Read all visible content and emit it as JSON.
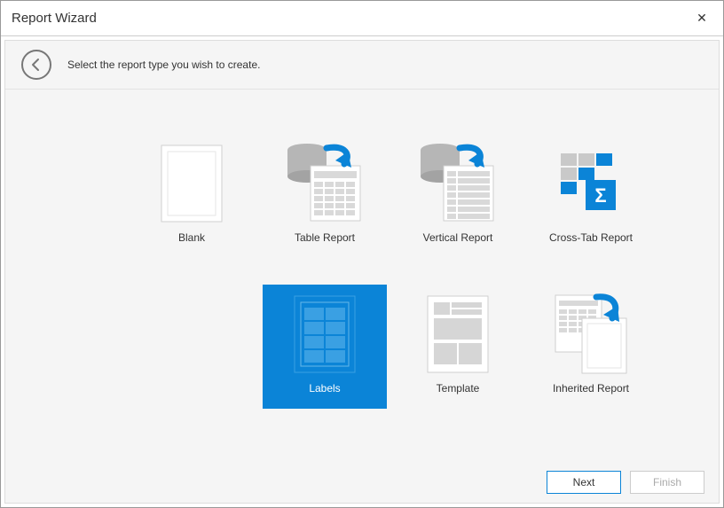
{
  "window": {
    "title": "Report Wizard",
    "close_glyph": "✕"
  },
  "header": {
    "instruction": "Select the report type you wish to create."
  },
  "tiles": {
    "blank": "Blank",
    "table": "Table Report",
    "vertical": "Vertical Report",
    "crosstab": "Cross-Tab Report",
    "labels": "Labels",
    "template": "Template",
    "inherited": "Inherited Report",
    "selected": "labels"
  },
  "footer": {
    "next": "Next",
    "finish": "Finish"
  },
  "colors": {
    "accent": "#0b84d7",
    "grey": "#b6b6b6",
    "page": "#ffffff",
    "page_border": "#cfcfcf"
  }
}
